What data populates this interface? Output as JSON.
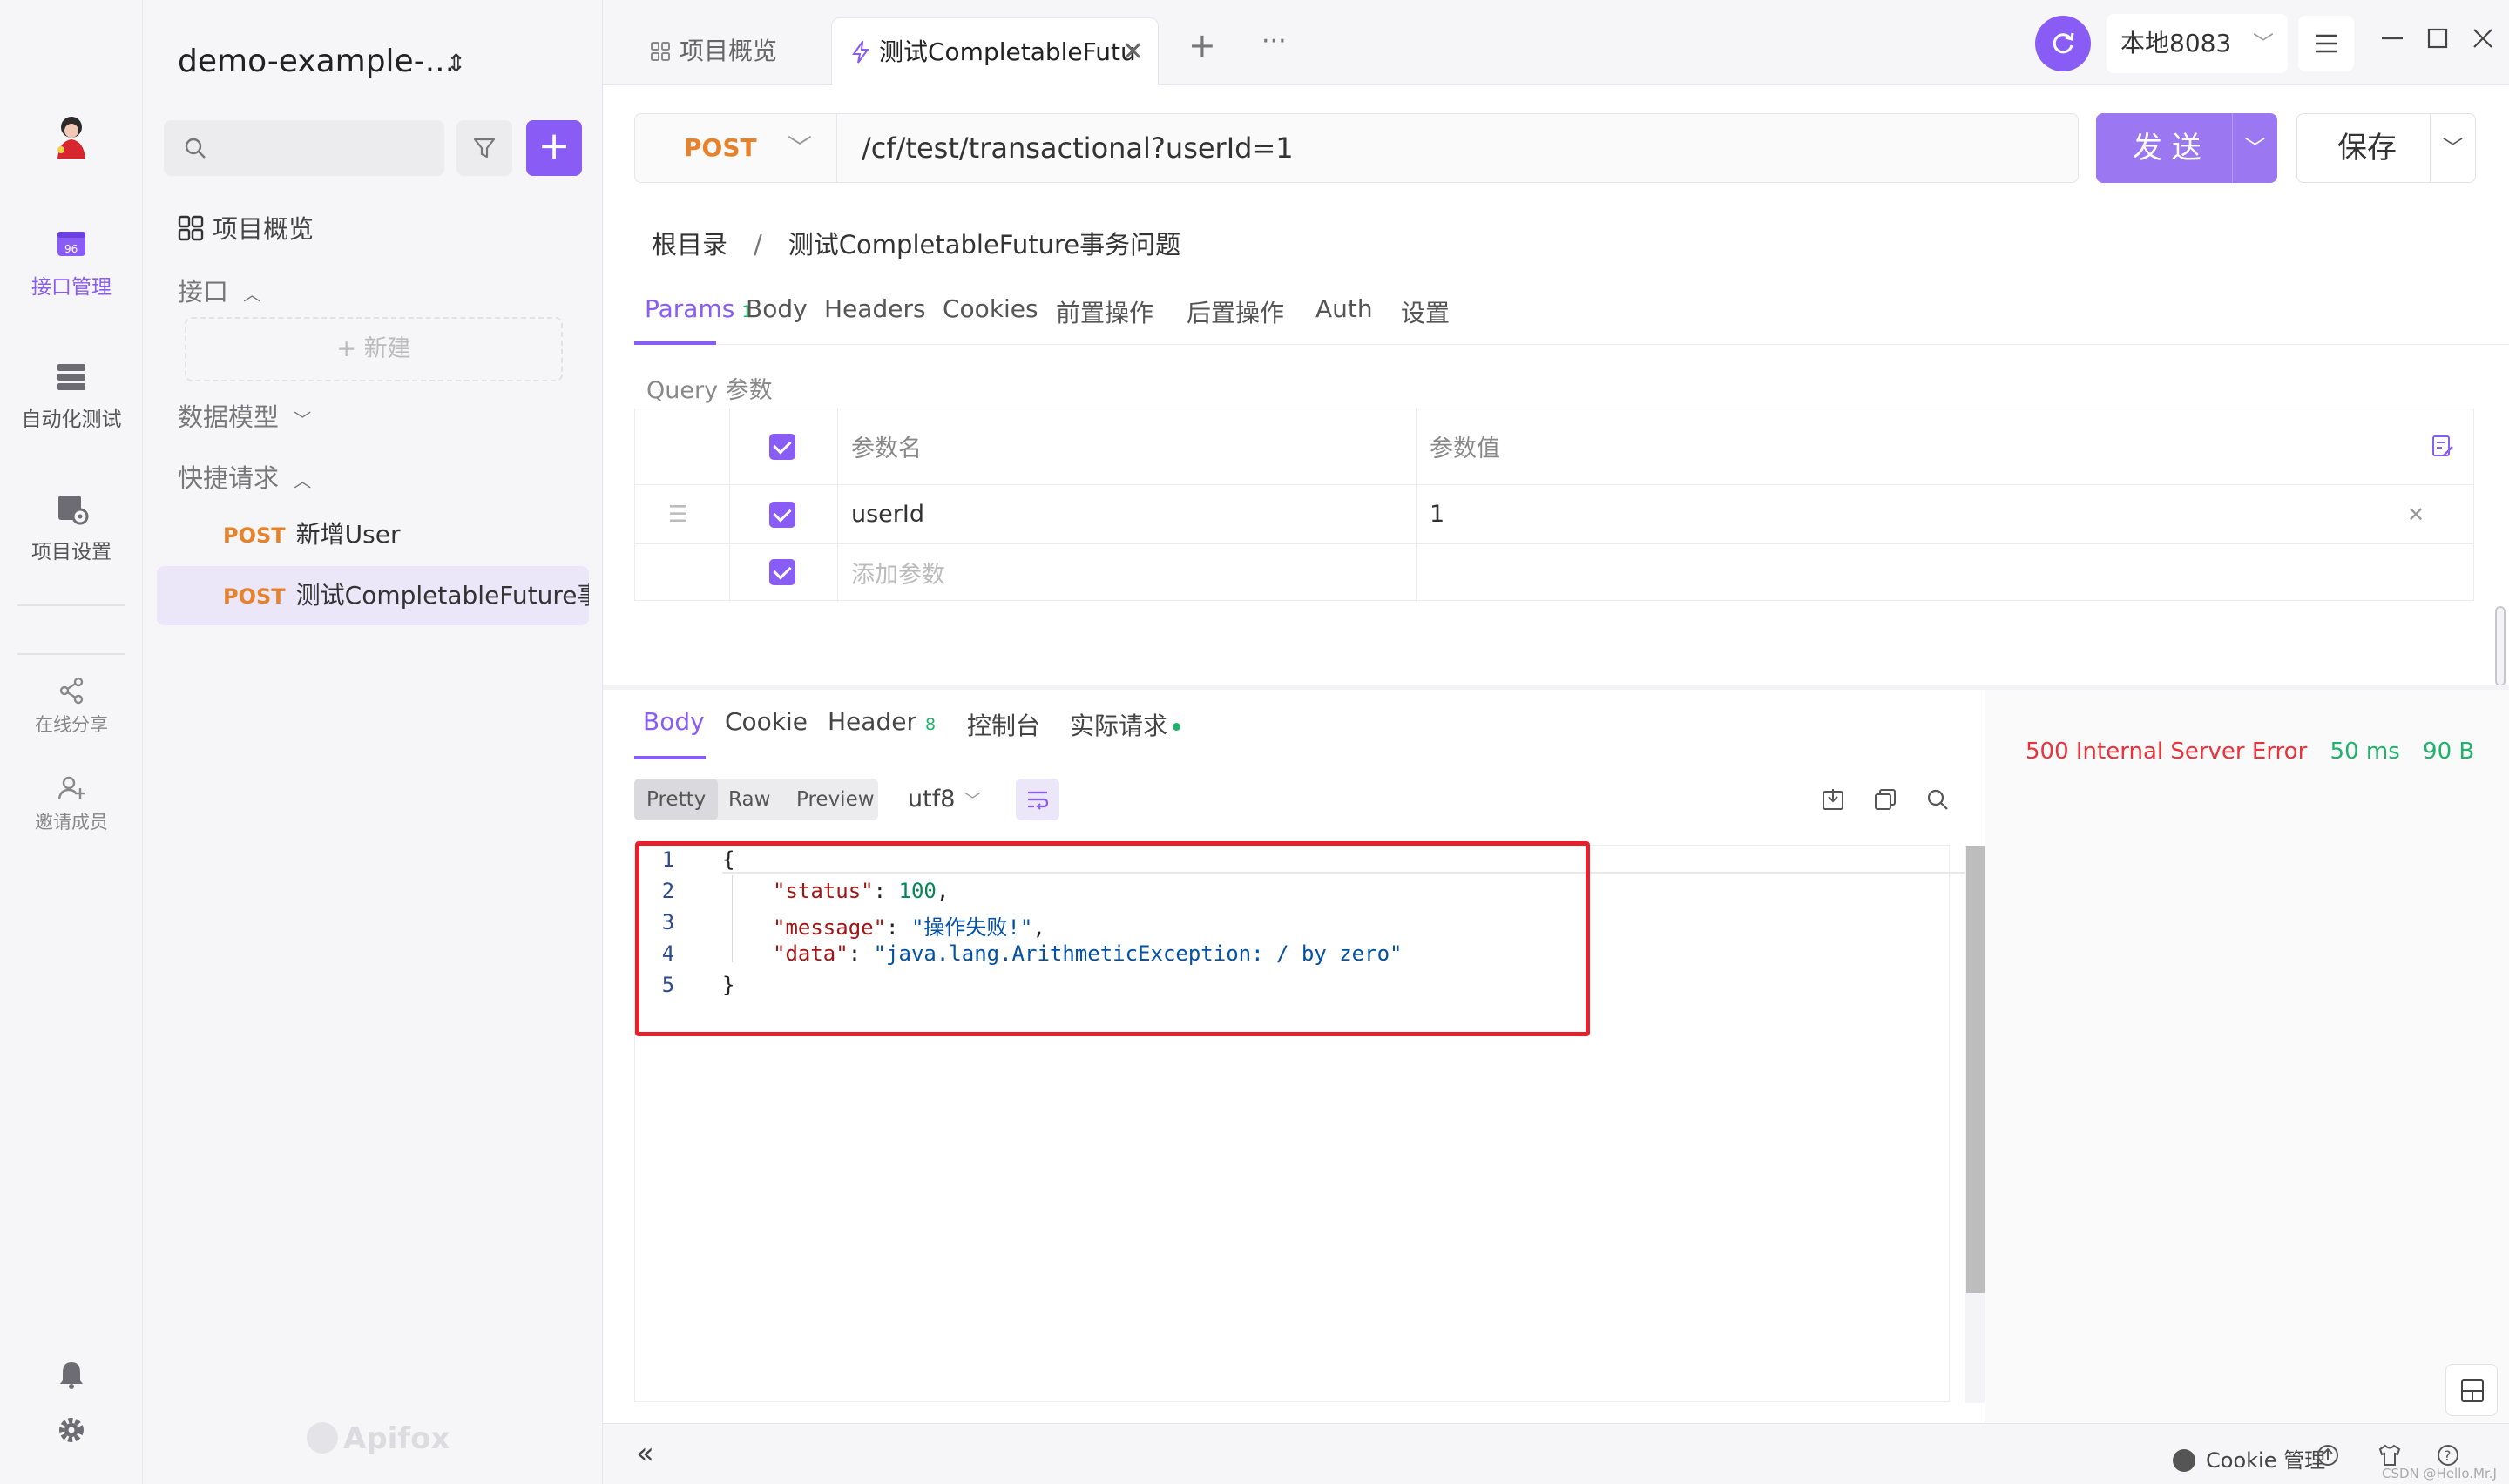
{
  "rail": {
    "items": [
      {
        "label": "接口管理",
        "icon": "api-management-icon",
        "active": true
      },
      {
        "label": "自动化测试",
        "icon": "automation-test-icon",
        "active": false
      },
      {
        "label": "项目设置",
        "icon": "project-settings-icon",
        "active": false
      }
    ],
    "share_label": "在线分享",
    "invite_label": "邀请成员"
  },
  "sidebar": {
    "project_name": "demo-example-...",
    "overview_label": "项目概览",
    "interfaces_label": "接口",
    "new_label": "+ 新建",
    "data_models_label": "数据模型",
    "quick_requests_label": "快捷请求",
    "requests": [
      {
        "method": "POST",
        "name": "新增User",
        "selected": false
      },
      {
        "method": "POST",
        "name": "测试CompletableFuture事...",
        "selected": true
      }
    ],
    "brand": "Apifox"
  },
  "tabs": [
    {
      "label": "项目概览",
      "active": false
    },
    {
      "label": "测试CompletableFutu",
      "active": true
    }
  ],
  "env": {
    "name": "本地8083"
  },
  "request": {
    "method": "POST",
    "url": "/cf/test/transactional?userId=1",
    "send_label": "发 送",
    "save_label": "保存"
  },
  "breadcrumb": {
    "root": "根目录",
    "separator": "/",
    "current": "测试CompletableFuture事务问题"
  },
  "param_tabs": [
    {
      "label": "Params",
      "count": "1",
      "active": true
    },
    {
      "label": "Body"
    },
    {
      "label": "Headers"
    },
    {
      "label": "Cookies"
    },
    {
      "label": "前置操作"
    },
    {
      "label": "后置操作"
    },
    {
      "label": "Auth"
    },
    {
      "label": "设置"
    }
  ],
  "query": {
    "section_label": "Query 参数",
    "col_name": "参数名",
    "col_value": "参数值",
    "rows": [
      {
        "name": "userId",
        "value": "1"
      }
    ],
    "add_placeholder": "添加参数"
  },
  "response": {
    "tabs": [
      {
        "label": "Body",
        "active": true
      },
      {
        "label": "Cookie"
      },
      {
        "label": "Header",
        "count": "8"
      },
      {
        "label": "控制台"
      },
      {
        "label": "实际请求"
      }
    ],
    "views": [
      "Pretty",
      "Raw",
      "Preview"
    ],
    "encoding": "utf8",
    "status": "500 Internal Server Error",
    "time": "50 ms",
    "size": "90 B",
    "line_numbers": [
      "1",
      "2",
      "3",
      "4",
      "5"
    ],
    "json_lines": {
      "open": "{",
      "status_key": "\"status\"",
      "status_val": "100",
      "message_key": "\"message\"",
      "message_val": "\"操作失败!\"",
      "data_key": "\"data\"",
      "data_val": "\"java.lang.ArithmeticException: / by zero\"",
      "close": "}"
    }
  },
  "footer": {
    "cookie_label": "Cookie 管理",
    "watermark": "CSDN @Hello.Mr.J"
  },
  "colors": {
    "accent": "#8a5cf6",
    "post": "#e6822b",
    "error": "#e8333c",
    "ok": "#20b26b",
    "highlight_box": "#e8202b"
  }
}
